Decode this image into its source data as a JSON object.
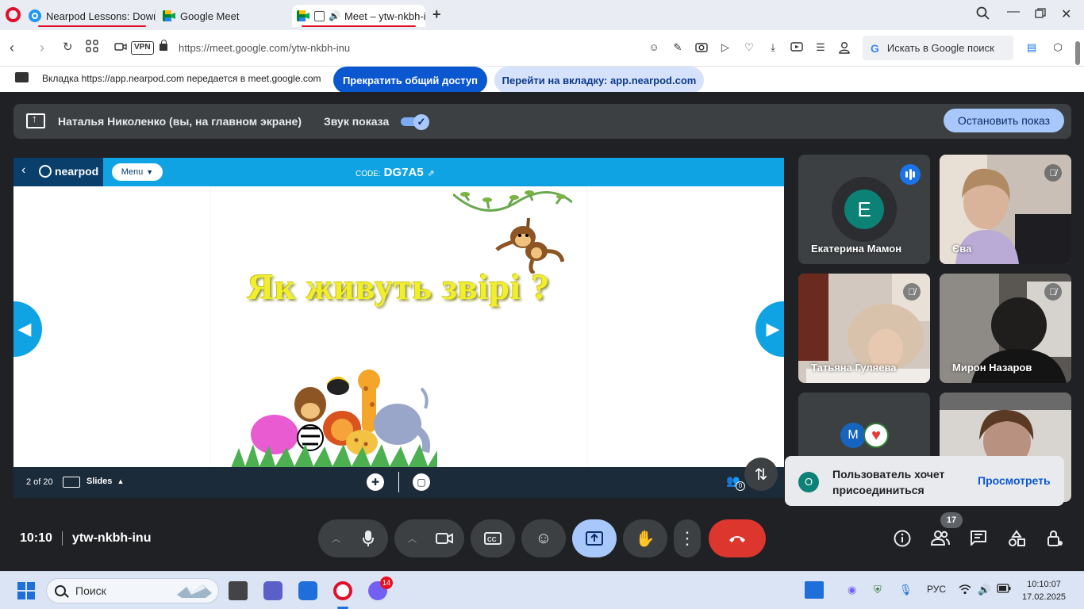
{
  "browser": {
    "tabs": [
      {
        "title": "Nearpod Lessons: Downlo"
      },
      {
        "title": "Google Meet"
      },
      {
        "title": "Meet – ytw-nkbh-i"
      }
    ],
    "url": "https://meet.google.com/ytw-nkbh-inu",
    "vpn_label": "VPN",
    "search_placeholder": "Искать в Google поиск"
  },
  "share_bar": {
    "message": "Вкладка https://app.nearpod.com передается в meet.google.com",
    "stop_label": "Прекратить общий доступ",
    "switch_label": "Перейти на вкладку: app.nearpod.com"
  },
  "presenter": {
    "name": "Наталья Николенко (вы, на главном экране)",
    "sound_label": "Звук показа",
    "sound_on": true,
    "stop_label": "Остановить показ"
  },
  "nearpod": {
    "logo_text": "nearpod",
    "menu_label": "Menu",
    "code_label": "CODE:",
    "code": "DG7A5",
    "slide_title": "Як живуть звірі ?",
    "page_indicator": "2 of 20",
    "slides_label": "Slides",
    "participants_count": "0"
  },
  "participants": [
    {
      "name": "Екатерина Мамон",
      "initial": "E",
      "speaking": true
    },
    {
      "name": "Єва",
      "muted": true
    },
    {
      "name": "Татьяна Гуляева",
      "muted": true
    },
    {
      "name": "Мирон Назаров",
      "muted": true
    },
    {
      "initial": "M"
    },
    {}
  ],
  "toast": {
    "initial": "O",
    "text": "Пользователь хочет присоединиться",
    "action": "Просмотреть"
  },
  "meeting": {
    "time": "10:10",
    "code": "ytw-nkbh-inu",
    "participant_badge": "17"
  },
  "taskbar": {
    "search_label": "Поиск",
    "lang": "РУС",
    "time": "10:10:07",
    "date": "17.02.2025",
    "viber_badge": "14"
  },
  "colors": {
    "meet_bg": "#202124",
    "nearpod_blue": "#0fa3e4",
    "end_call_red": "#dc362e",
    "present_active": "#a8c7fa"
  }
}
